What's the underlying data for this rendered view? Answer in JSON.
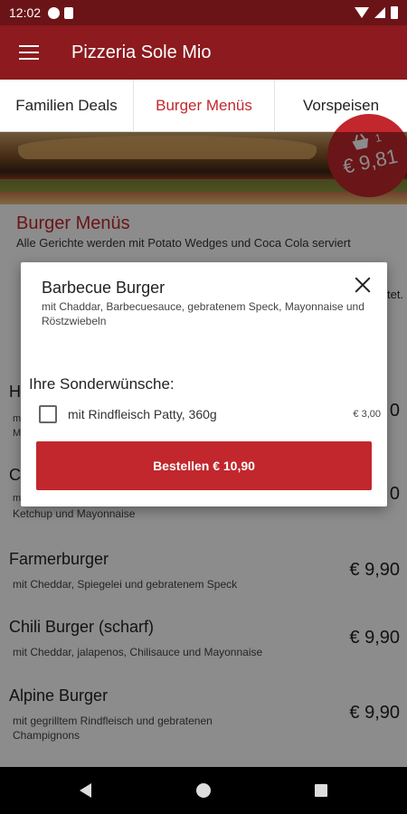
{
  "status_bar": {
    "time": "12:02"
  },
  "app_bar": {
    "title": "Pizzeria Sole Mio"
  },
  "tabs": [
    {
      "label": "Familien Deals"
    },
    {
      "label": "Burger Menüs"
    },
    {
      "label": "Vorspeisen"
    }
  ],
  "cart": {
    "count": "1",
    "total": "€ 9,81"
  },
  "section": {
    "title": "Burger Menüs",
    "description": "Alle Gerichte werden mit Potato Wedges und Coca Cola serviert"
  },
  "menu_items": [
    {
      "name": "H",
      "description": "m",
      "description2": "M",
      "price": "0"
    },
    {
      "name": "C",
      "description": "m",
      "description2": "Ketchup und Mayonnaise",
      "price": "0"
    },
    {
      "name": "Farmerburger",
      "description": "mit Cheddar, Spiegelei und gebratenem Speck",
      "price": "€ 9,90"
    },
    {
      "name": "Chili Burger (scharf)",
      "description": "mit Cheddar, jalapenos, Chilisauce und Mayonnaise",
      "price": "€ 9,90"
    },
    {
      "name": "Alpine Burger",
      "description": "mit gegrilltem Rindfleisch und gebratenen Champignons",
      "price": "€ 9,90"
    }
  ],
  "dialog": {
    "title": "Barbecue Burger",
    "description": "mit Chaddar, Barbecuesauce, gebratenem Speck, Mayonnaise und Röstzwiebeln",
    "extras_heading": "Ihre Sonderwünsche:",
    "extras": [
      {
        "label": "mit Rindfleisch Patty, 360g",
        "price": "€ 3,00",
        "checked": false
      }
    ],
    "order_button": "Bestellen € 10,90"
  },
  "section_desc_clipped": "tet."
}
